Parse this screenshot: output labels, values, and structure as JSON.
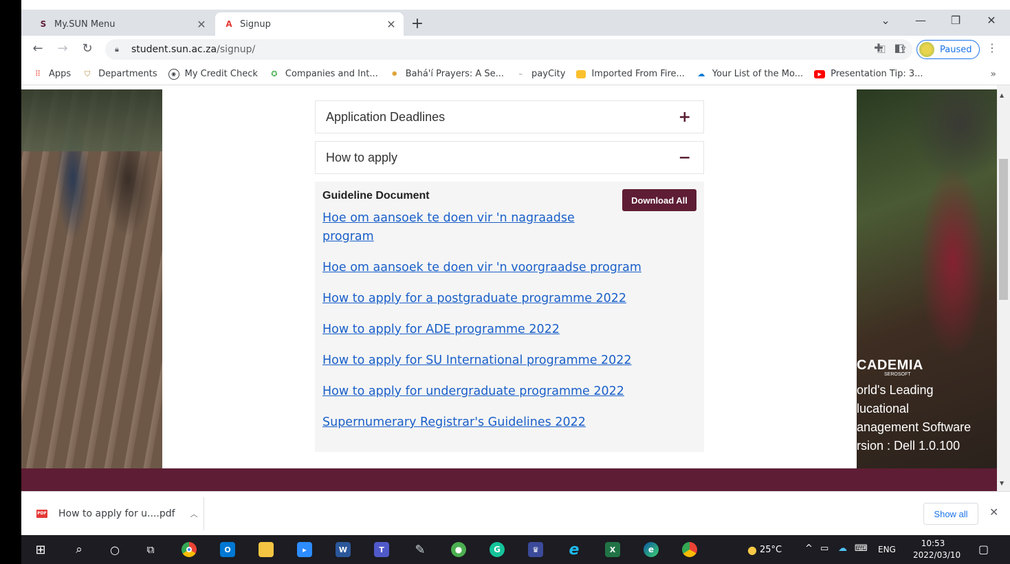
{
  "browser": {
    "tabs": [
      {
        "title": "My.SUN Menu",
        "favicon": "S"
      },
      {
        "title": "Signup",
        "favicon": "A"
      }
    ],
    "url_host": "student.sun.ac.za",
    "url_path": "/signup/",
    "profile_label": "Paused"
  },
  "bookmarks": [
    {
      "label": "Apps",
      "icon": "apps-grid-icon"
    },
    {
      "label": "Departments",
      "icon": "shield-icon"
    },
    {
      "label": "My Credit Check",
      "icon": "credit-icon"
    },
    {
      "label": "Companies and Int...",
      "icon": "globe-icon"
    },
    {
      "label": "Bahá'í Prayers: A Se...",
      "icon": "star-icon"
    },
    {
      "label": "payCity",
      "icon": "paycity-icon"
    },
    {
      "label": "Imported From Fire...",
      "icon": "folder-icon"
    },
    {
      "label": "Your List of the Mo...",
      "icon": "cloud-icon"
    },
    {
      "label": "Presentation Tip: 3...",
      "icon": "youtube-icon"
    }
  ],
  "page": {
    "accordion": [
      {
        "title": "Application Deadlines",
        "sign": "+"
      },
      {
        "title": "How to apply",
        "sign": "−"
      }
    ],
    "guideline_title": "Guideline Document",
    "download_all": "Download All",
    "links": [
      "Hoe om aansoek te doen vir 'n nagraadse program",
      "Hoe om aansoek te doen vir 'n voorgraadse program",
      "How to apply for a postgraduate programme 2022",
      "How to apply for ADE programme 2022",
      "How to apply for SU International programme 2022",
      "How to apply for undergraduate programme 2022",
      "Supernumerary Registrar's Guidelines 2022"
    ],
    "ad": {
      "brand": "CADEMIA",
      "sub": "SEROSOFT",
      "lines": [
        "orld's Leading",
        "lucational",
        "anagement Software",
        "rsion : Dell 1.0.100"
      ]
    }
  },
  "download_bar": {
    "file": "How to apply for u....pdf",
    "show_all": "Show all"
  },
  "taskbar": {
    "weather": "25°C",
    "lang": "ENG",
    "time": "10:53",
    "date": "2022/03/10"
  }
}
